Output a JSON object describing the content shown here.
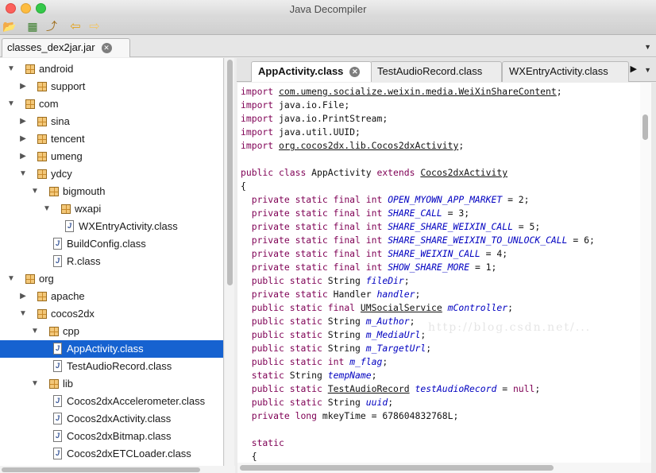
{
  "window": {
    "title": "Java Decompiler"
  },
  "toolbar": {
    "icons": [
      "open-file-icon",
      "open-type-icon",
      "navigate-icon",
      "back-arrow-icon",
      "forward-arrow-icon"
    ]
  },
  "file_tab": {
    "label": "classes_dex2jar.jar"
  },
  "tree": [
    {
      "label": "android",
      "type": "package",
      "expanded": true
    },
    {
      "label": "support",
      "type": "package",
      "expanded": false
    },
    {
      "label": "com",
      "type": "package",
      "expanded": true
    },
    {
      "label": "sina",
      "type": "package",
      "expanded": false
    },
    {
      "label": "tencent",
      "type": "package",
      "expanded": false
    },
    {
      "label": "umeng",
      "type": "package",
      "expanded": false
    },
    {
      "label": "ydcy",
      "type": "package",
      "expanded": true
    },
    {
      "label": "bigmouth",
      "type": "package",
      "expanded": true
    },
    {
      "label": "wxapi",
      "type": "package",
      "expanded": true
    },
    {
      "label": "WXEntryActivity.class",
      "type": "class"
    },
    {
      "label": "BuildConfig.class",
      "type": "class"
    },
    {
      "label": "R.class",
      "type": "class"
    },
    {
      "label": "org",
      "type": "package",
      "expanded": true
    },
    {
      "label": "apache",
      "type": "package",
      "expanded": false
    },
    {
      "label": "cocos2dx",
      "type": "package",
      "expanded": true
    },
    {
      "label": "cpp",
      "type": "package",
      "expanded": true
    },
    {
      "label": "AppActivity.class",
      "type": "class",
      "selected": true
    },
    {
      "label": "TestAudioRecord.class",
      "type": "class"
    },
    {
      "label": "lib",
      "type": "package",
      "expanded": true
    },
    {
      "label": "Cocos2dxAccelerometer.class",
      "type": "class"
    },
    {
      "label": "Cocos2dxActivity.class",
      "type": "class"
    },
    {
      "label": "Cocos2dxBitmap.class",
      "type": "class"
    },
    {
      "label": "Cocos2dxETCLoader.class",
      "type": "class"
    }
  ],
  "editor_tabs": [
    {
      "label": "AppActivity.class",
      "active": true
    },
    {
      "label": "TestAudioRecord.class",
      "active": false
    },
    {
      "label": "WXEntryActivity.class",
      "active": false
    }
  ],
  "code_lines": [
    "import com.umeng.socialize.weixin.media.WeiXinShareContent;",
    "import java.io.File;",
    "import java.io.PrintStream;",
    "import java.util.UUID;",
    "import org.cocos2dx.lib.Cocos2dxActivity;",
    "",
    "public class AppActivity extends Cocos2dxActivity",
    "{",
    "  private static final int OPEN_MYOWN_APP_MARKET = 2;",
    "  private static final int SHARE_CALL = 3;",
    "  private static final int SHARE_SHARE_WEIXIN_CALL = 5;",
    "  private static final int SHARE_SHARE_WEIXIN_TO_UNLOCK_CALL = 6;",
    "  private static final int SHARE_WEIXIN_CALL = 4;",
    "  private static final int SHOW_SHARE_MORE = 1;",
    "  public static String fileDir;",
    "  private static Handler handler;",
    "  public static final UMSocialService mController;",
    "  public static String m_Author;",
    "  public static String m_MediaUrl;",
    "  public static String m_TargetUrl;",
    "  public static int m_flag;",
    "  static String tempName;",
    "  public static TestAudioRecord testAudioRecord = null;",
    "  public static String uuid;",
    "  private long mkeyTime = 678604832768L;",
    "",
    "  static",
    "  {"
  ],
  "watermark": "http://blog.csdn.net/..."
}
